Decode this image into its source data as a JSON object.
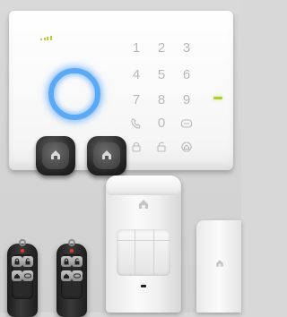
{
  "panel": {
    "keys": [
      {
        "label": "1"
      },
      {
        "label": "2"
      },
      {
        "label": "3"
      },
      {
        "label": "4"
      },
      {
        "label": "5"
      },
      {
        "label": "6"
      },
      {
        "label": "7"
      },
      {
        "label": "8"
      },
      {
        "label": "9"
      },
      {
        "icon": "phone-icon"
      },
      {
        "label": "0"
      },
      {
        "icon": "sos-icon"
      },
      {
        "icon": "lock-closed-icon"
      },
      {
        "icon": "lock-open-icon"
      },
      {
        "icon": "home-icon"
      }
    ],
    "ring_color": "#5aa9f2",
    "status_led_color": "#a8cf3a",
    "signal_color": "#b7d236"
  },
  "devices": {
    "tags": 2,
    "remotes": 2,
    "pir_sensor": 1,
    "door_sensor": 1
  }
}
